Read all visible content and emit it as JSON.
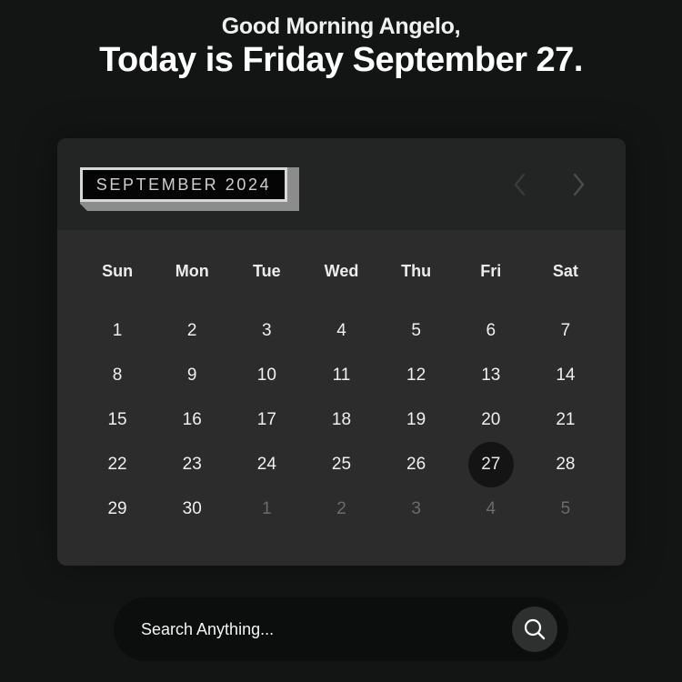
{
  "greeting": "Good Morning Angelo,",
  "today_text": "Today is Friday September 27.",
  "calendar": {
    "month_label": "SEPTEMBER 2024",
    "prev_icon": "chevron-left-icon",
    "next_icon": "chevron-right-icon",
    "weekdays": [
      "Sun",
      "Mon",
      "Tue",
      "Wed",
      "Thu",
      "Fri",
      "Sat"
    ],
    "days": [
      {
        "label": "1"
      },
      {
        "label": "2"
      },
      {
        "label": "3"
      },
      {
        "label": "4"
      },
      {
        "label": "5"
      },
      {
        "label": "6"
      },
      {
        "label": "7"
      },
      {
        "label": "8"
      },
      {
        "label": "9"
      },
      {
        "label": "10"
      },
      {
        "label": "11"
      },
      {
        "label": "12"
      },
      {
        "label": "13"
      },
      {
        "label": "14"
      },
      {
        "label": "15"
      },
      {
        "label": "16"
      },
      {
        "label": "17"
      },
      {
        "label": "18"
      },
      {
        "label": "19"
      },
      {
        "label": "20"
      },
      {
        "label": "21"
      },
      {
        "label": "22"
      },
      {
        "label": "23"
      },
      {
        "label": "24"
      },
      {
        "label": "25"
      },
      {
        "label": "26"
      },
      {
        "label": "27",
        "selected": true
      },
      {
        "label": "28"
      },
      {
        "label": "29"
      },
      {
        "label": "30"
      },
      {
        "label": "1",
        "outside": true
      },
      {
        "label": "2",
        "outside": true
      },
      {
        "label": "3",
        "outside": true
      },
      {
        "label": "4",
        "outside": true
      },
      {
        "label": "5",
        "outside": true
      }
    ]
  },
  "search": {
    "placeholder": "Search Anything...",
    "value": "",
    "icon": "search-icon"
  },
  "colors": {
    "background": "#131515",
    "calendar_body": "#2c2c2c",
    "calendar_header": "#232424",
    "selected_day": "#141414",
    "outside_day_text": "#6b6b6b",
    "search_bar": "#0c0d0d"
  }
}
